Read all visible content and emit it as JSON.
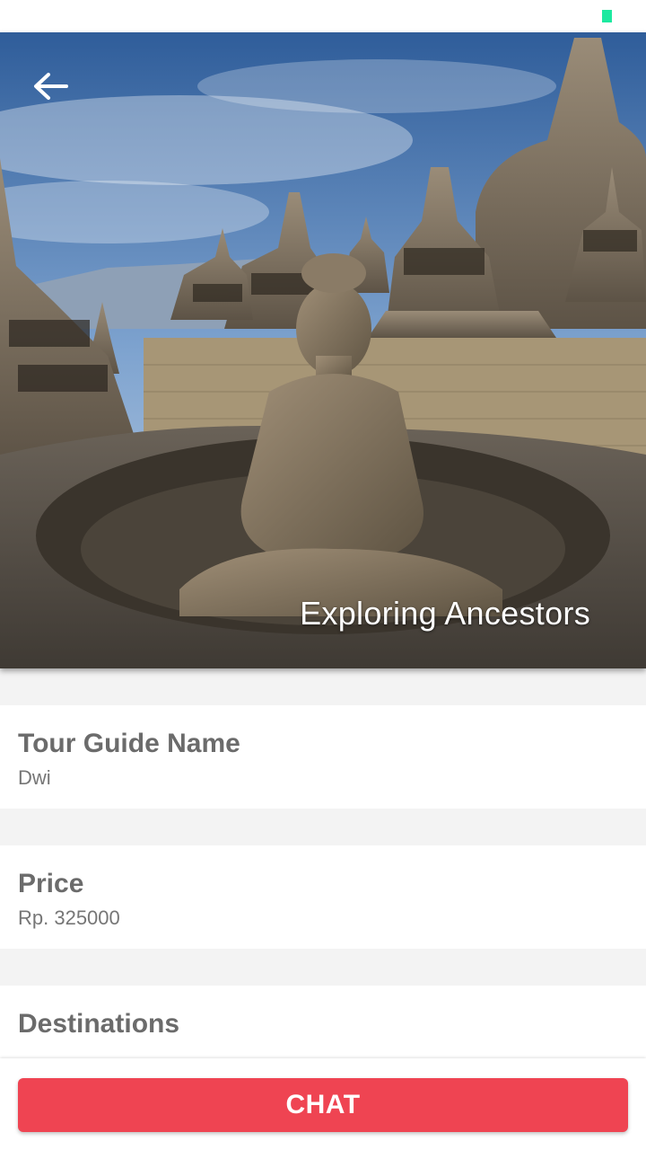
{
  "status_bar": {
    "battery_color": "#1de9a0"
  },
  "hero": {
    "title": "Exploring Ancestors",
    "back_icon": "arrow-left-icon"
  },
  "guide": {
    "label": "Tour Guide Name",
    "value": "Dwi"
  },
  "price": {
    "label": "Price",
    "value": "Rp. 325000"
  },
  "destinations": {
    "label": "Destinations"
  },
  "actions": {
    "chat_label": "CHAT",
    "chat_color": "#ef4452"
  }
}
